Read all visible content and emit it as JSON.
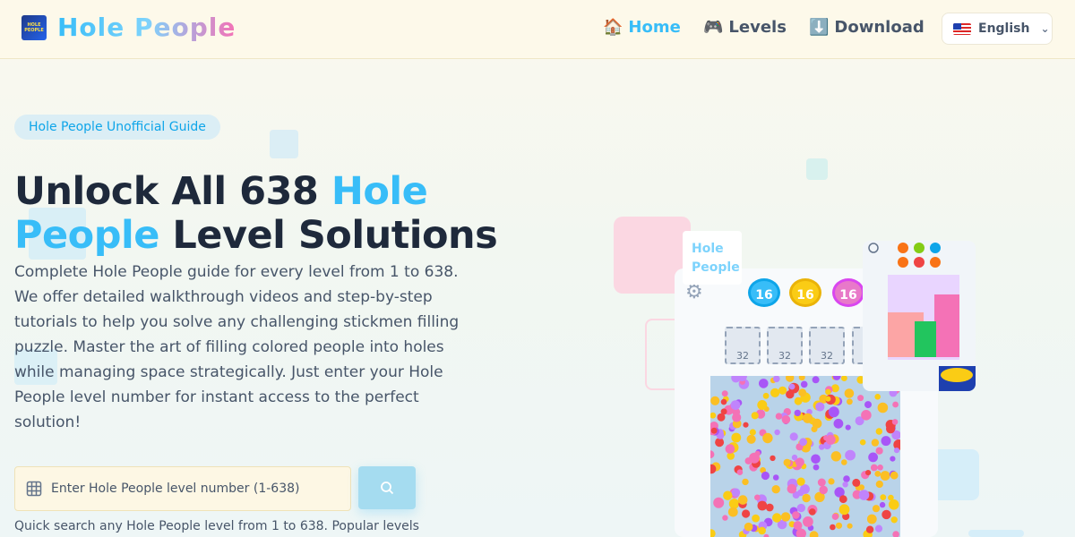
{
  "header": {
    "logo_text": "Hole People",
    "logo_img_text": "HOLE PEOPLE",
    "nav": [
      {
        "label": "Home",
        "icon": "house-icon",
        "glyph": "🏠"
      },
      {
        "label": "Levels",
        "icon": "gamepad-icon",
        "glyph": "🎮"
      },
      {
        "label": "Download",
        "icon": "download-icon",
        "glyph": "⬇️"
      }
    ],
    "language": "English"
  },
  "hero": {
    "badge": "Hole People Unofficial Guide",
    "headline_part1": "Unlock All 638 ",
    "headline_accent1": "Hole",
    "headline_accent2": "People",
    "headline_part2": " Level Solutions",
    "description": "Complete Hole People guide for every level from 1 to 638. We offer detailed walkthrough videos and step-by-step tutorials to help you solve any challenging stickmen filling puzzle. Master the art of filling colored people into holes while managing space strategically. Just enter your Hole People level number for instant access to the perfect solution!",
    "search_placeholder": "Enter Hole People level number (1-638)",
    "hint": "Quick search any Hole People level from 1 to 638. Popular levels"
  },
  "preview": {
    "tokens": [
      "16",
      "16",
      "16"
    ],
    "slots": [
      "32",
      "32",
      "32",
      "32"
    ],
    "word_card_line1": "Hole",
    "word_card_line2": "People"
  },
  "colors": {
    "accent": "#38bdf8",
    "pink": "#f472b6",
    "dark": "#1e293b"
  }
}
